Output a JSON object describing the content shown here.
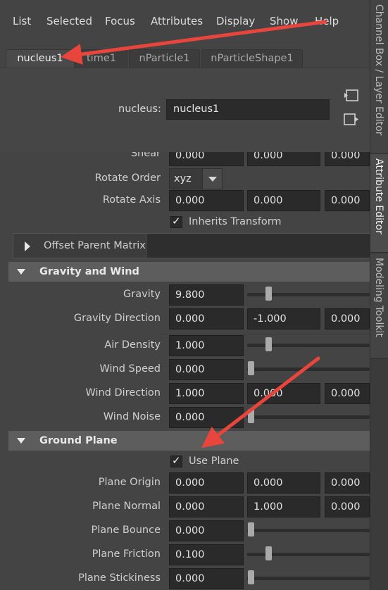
{
  "menu": {
    "items": [
      "List",
      "Selected",
      "Focus",
      "Attributes",
      "Display",
      "Show",
      "Help"
    ]
  },
  "tabs": [
    "nucleus1",
    "time1",
    "nParticle1",
    "nParticleShape1"
  ],
  "node": {
    "label": "nucleus:",
    "value": "nucleus1"
  },
  "transform": {
    "shear_label": "Shear",
    "shear": [
      "0.000",
      "0.000",
      "0.000"
    ],
    "rotate_order_label": "Rotate Order",
    "rotate_order_value": "xyz",
    "rotate_axis_label": "Rotate Axis",
    "rotate_axis": [
      "0.000",
      "0.000",
      "0.000"
    ],
    "inherits_label": "Inherits Transform",
    "inherits_checked": true,
    "offset_parent_label": "Offset Parent Matrix"
  },
  "gravity_wind": {
    "title": "Gravity and Wind",
    "gravity_label": "Gravity",
    "gravity_value": "9.800",
    "gravity_slider": 0.1,
    "gravity_dir_label": "Gravity Direction",
    "gravity_dir": [
      "0.000",
      "-1.000",
      "0.000"
    ],
    "air_density_label": "Air Density",
    "air_density_value": "1.000",
    "air_density_slider": 0.1,
    "wind_speed_label": "Wind Speed",
    "wind_speed_value": "0.000",
    "wind_speed_slider": 0.0,
    "wind_dir_label": "Wind Direction",
    "wind_dir": [
      "1.000",
      "0.000",
      "0.000"
    ],
    "wind_noise_label": "Wind Noise",
    "wind_noise_value": "0.000",
    "wind_noise_slider": 0.0
  },
  "ground_plane": {
    "title": "Ground Plane",
    "use_plane_label": "Use Plane",
    "use_plane_checked": true,
    "origin_label": "Plane Origin",
    "origin": [
      "0.000",
      "0.000",
      "0.000"
    ],
    "normal_label": "Plane Normal",
    "normal": [
      "0.000",
      "1.000",
      "0.000"
    ],
    "bounce_label": "Plane Bounce",
    "bounce_value": "0.000",
    "bounce_slider": 0.0,
    "friction_label": "Plane Friction",
    "friction_value": "0.100",
    "friction_slider": 0.1,
    "stickiness_label": "Plane Stickiness",
    "stickiness_value": "0.000",
    "stickiness_slider": 0.0
  },
  "side_tabs": [
    "Channel Box / Layer Editor",
    "Attribute Editor",
    "Modeling Toolkit"
  ],
  "colors": {
    "annotation_arrow": "#e8453c",
    "panel_bg": "#444444",
    "field_bg": "#2a2a2a",
    "header_bg": "#5d5d5d"
  },
  "icons": [
    "load-attributes-icon",
    "copy-tab-icon",
    "checkbox-check-icon",
    "expand-triangle-icon",
    "collapse-triangle-icon",
    "dropdown-arrow-icon"
  ]
}
